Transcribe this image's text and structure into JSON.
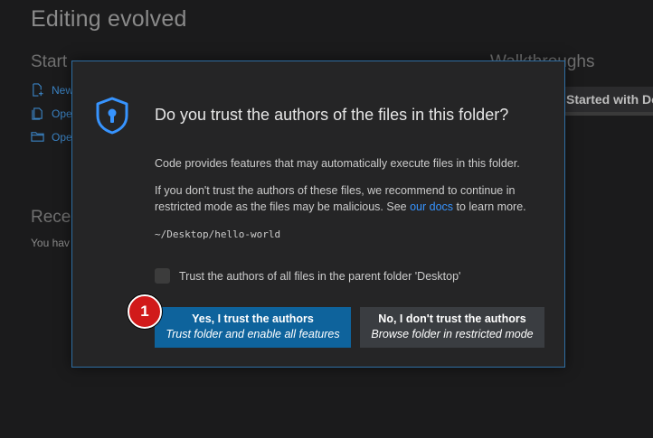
{
  "background": {
    "title": "Editing evolved",
    "start_heading": "Start",
    "start_items": [
      "New",
      "Ope",
      "Ope"
    ],
    "recent_heading": "Recer",
    "recent_text": "You hav",
    "walkthroughs_heading": "Walkthroughs",
    "walkthrough_card": "Started with Do"
  },
  "dialog": {
    "title": "Do you trust the authors of the files in this folder?",
    "paragraph1": "Code provides features that may automatically execute files in this folder.",
    "paragraph2_before": "If you don't trust the authors of these files, we recommend to continue in restricted mode as the files may be malicious. See ",
    "paragraph2_link": "our docs",
    "paragraph2_after": " to learn more.",
    "path": "~/Desktop/hello-world",
    "checkbox_label": "Trust the authors of all files in the parent folder 'Desktop'",
    "checkbox_checked": false,
    "yes_button": {
      "main": "Yes, I trust the authors",
      "sub": "Trust folder and enable all features"
    },
    "no_button": {
      "main": "No, I don't trust the authors",
      "sub": "Browse folder in restricted mode"
    }
  },
  "badge": {
    "number": "1",
    "color": "#d11a1a"
  },
  "colors": {
    "accent": "#0e639c",
    "link": "#3794ff",
    "dialog_border": "#2f6ea3",
    "shield": "#3794ff"
  },
  "icons": {
    "dialog": "shield-lock-icon",
    "new_file": "new-file-icon",
    "open_file": "open-file-icon",
    "open_folder": "folder-icon"
  }
}
